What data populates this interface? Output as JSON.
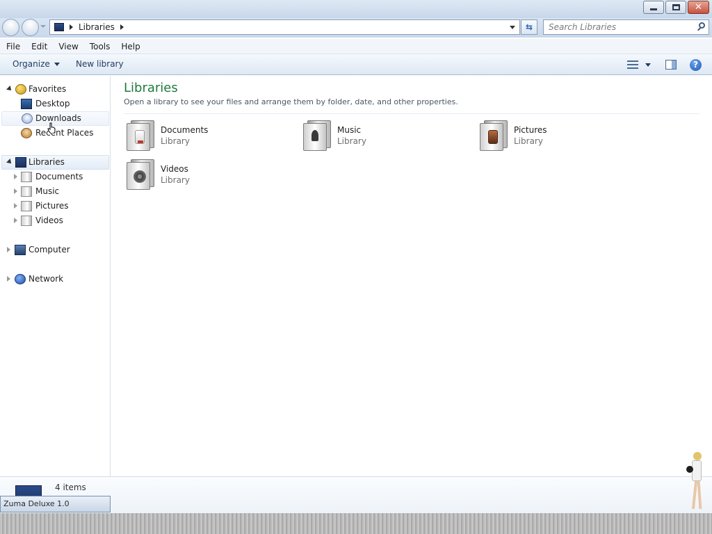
{
  "window": {
    "caption_buttons": {
      "minimize_icon": "minimize-icon",
      "maximize_icon": "restore-icon",
      "close_icon": "close-icon",
      "close_glyph": "✕"
    }
  },
  "address_bar": {
    "crumbs": [
      "Libraries"
    ],
    "refresh_glyph": "⇆"
  },
  "search": {
    "placeholder": "Search Libraries"
  },
  "menu": [
    "File",
    "Edit",
    "View",
    "Tools",
    "Help"
  ],
  "command_bar": {
    "organize": "Organize",
    "new_library": "New library",
    "help_glyph": "?"
  },
  "nav_pane": {
    "favorites": {
      "label": "Favorites",
      "items": [
        "Desktop",
        "Downloads",
        "Recent Places"
      ]
    },
    "libraries": {
      "label": "Libraries",
      "items": [
        "Documents",
        "Music",
        "Pictures",
        "Videos"
      ]
    },
    "computer": "Computer",
    "network": "Network"
  },
  "content": {
    "title": "Libraries",
    "subtitle": "Open a library to see your files and arrange them by folder, date, and other properties.",
    "items": [
      {
        "name": "Documents",
        "type": "Library",
        "icon": "documents-library-icon"
      },
      {
        "name": "Music",
        "type": "Library",
        "icon": "music-library-icon"
      },
      {
        "name": "Pictures",
        "type": "Library",
        "icon": "pictures-library-icon"
      },
      {
        "name": "Videos",
        "type": "Library",
        "icon": "videos-library-icon"
      }
    ]
  },
  "details": {
    "count": "4 items"
  },
  "taskbar": {
    "label": "Zuma Deluxe 1.0"
  },
  "colors": {
    "title_green": "#1e7a3c",
    "accent_blue": "#1f58b4"
  }
}
